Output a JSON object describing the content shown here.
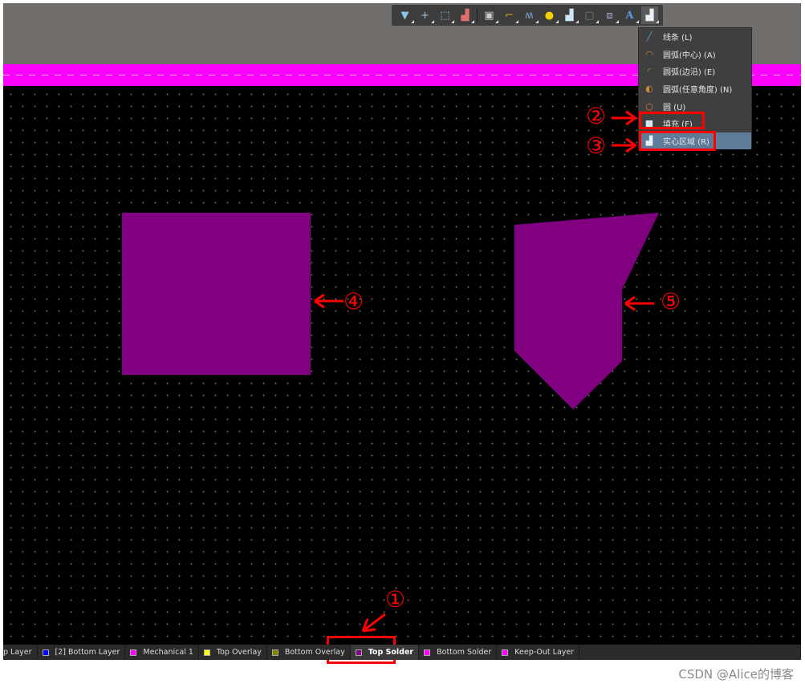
{
  "toolbar": {
    "icons": [
      "filter-icon",
      "crosshair-icon",
      "select-rect-icon",
      "align-icon",
      "component-icon",
      "route-icon",
      "interactive-length-icon",
      "pad-icon",
      "solid-region-icon",
      "placeholder-icon",
      "net-label-icon",
      "text-icon",
      "region-icon"
    ]
  },
  "menu": {
    "items": [
      {
        "label": "线条 (L)",
        "icon": "line-icon"
      },
      {
        "label": "圆弧(中心) (A)",
        "icon": "arc-center-icon"
      },
      {
        "label": "圆弧(边沿) (E)",
        "icon": "arc-edge-icon"
      },
      {
        "label": "圆弧(任意角度) (N)",
        "icon": "arc-any-angle-icon"
      },
      {
        "label": "圆 (U)",
        "icon": "circle-icon"
      },
      {
        "label": "填充 (F)",
        "icon": "fill-icon"
      },
      {
        "label": "实心区域 (R)",
        "icon": "solid-region-icon",
        "active": true
      }
    ]
  },
  "annotations": [
    "①",
    "②",
    "③",
    "④",
    "⑤"
  ],
  "colors": {
    "shape": "#800080",
    "annotation": "#ff0000",
    "canvas": "#000000",
    "keepout_band": "#ff00ff"
  },
  "layers": [
    {
      "label": "p Layer",
      "color": "#d02020"
    },
    {
      "label": "[2] Bottom Layer",
      "color": "#0000ff"
    },
    {
      "label": "Mechanical 1",
      "color": "#ff00ff"
    },
    {
      "label": "Top Overlay",
      "color": "#ffff00"
    },
    {
      "label": "Bottom Overlay",
      "color": "#808000"
    },
    {
      "label": "Top Solder",
      "color": "#800080",
      "active": true
    },
    {
      "label": "Bottom Solder",
      "color": "#ff00ff"
    },
    {
      "label": "Keep-Out Layer",
      "color": "#ff00ff"
    }
  ],
  "watermark": "CSDN @Alice的博客"
}
